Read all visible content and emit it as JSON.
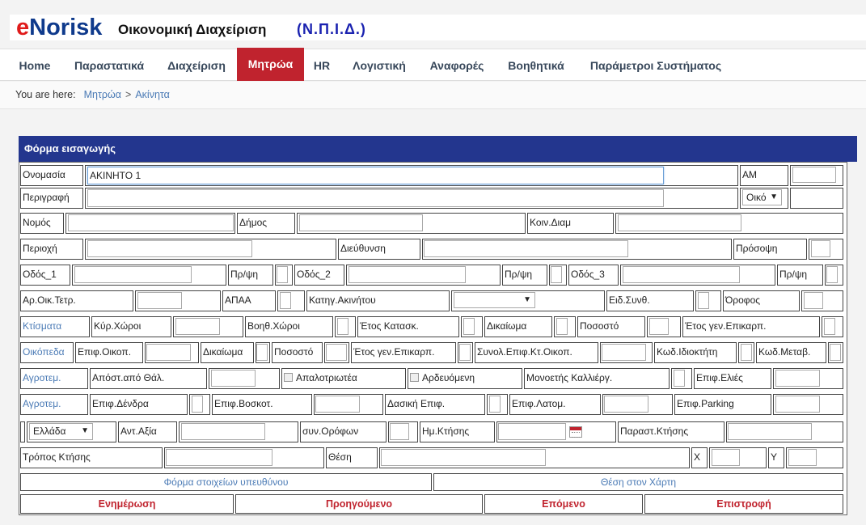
{
  "header": {
    "logo_e": "e",
    "logo_rest": "Norisk",
    "title": "Οικονομική Διαχείριση",
    "org": "(Ν.Π.Ι.Δ.)"
  },
  "nav": {
    "items": [
      "Home",
      "Παραστατικά",
      "Διαχείριση",
      "Μητρώα",
      "HR",
      "Λογιστική",
      "Αναφορές",
      "Βοηθητικά",
      "Παράμετροι Συστήματος"
    ],
    "active": "Μητρώα"
  },
  "breadcrumb": {
    "label": "You are here:",
    "items": [
      "Μητρώα",
      "Ακίνητα"
    ],
    "separator": ">"
  },
  "form": {
    "title": "Φόρμα εισαγωγής",
    "labels": {
      "onomasia": "Ονομασία",
      "am": "ΑΜ",
      "perigrafi": "Περιγραφή",
      "nomos": "Νομός",
      "dimos": "Δήμος",
      "koin_diam": "Κοιν.Διαμ",
      "perioxi": "Περιοχή",
      "dieuthynsi": "Διεύθυνση",
      "prosopsi": "Πρόσοψη",
      "odos_1": "Οδός_1",
      "odos_2": "Οδός_2",
      "odos_3": "Οδός_3",
      "pr_psi": "Πρ/ψη",
      "ar_oik_tetr": "Αρ.Οικ.Τετρ.",
      "apaa": "ΑΠΑΑ",
      "katig_akinitou": "Κατηγ.Ακινήτου",
      "eid_synth": "Ειδ.Συνθ.",
      "orofos": "Όροφος",
      "ktismata": "Κτίσματα",
      "kyr_xoroi": "Κύρ.Χώροι",
      "voith_xoroi": "Βοηθ.Χώροι",
      "etos_katask": "Έτος Κατασκ.",
      "dikaioma": "Δικαίωμα",
      "pososto": "Ποσοστό",
      "etos_gen_epikarp": "Έτος γεν.Επικαρπ.",
      "oikopeda": "Οικόπεδα",
      "epif_oikop": "Επιφ.Οικοπ.",
      "synol_epif": "Συνολ.Επιφ.Κτ.Οικοπ.",
      "kod_idioktiti": "Κωδ.Ιδιοκτήτη",
      "kod_metav": "Κωδ.Μεταβ.",
      "agrotem": "Αγροτεμ.",
      "apost_thal": "Απόστ.από Θάλ.",
      "apalotriotea": "Απαλοτριωτέα",
      "ardevomeni": "Αρδευόμενη",
      "monoetis": "Μονοετής Καλλιέργ.",
      "epif_elies": "Επιφ.Ελιές",
      "epif_dendra": "Επιφ.Δένδρα",
      "epif_voskot": "Επιφ.Βοσκοτ.",
      "dasiki_epif": "Δασική Επιφ.",
      "epif_latom": "Επιφ.Λατομ.",
      "epif_parking": "Επιφ.Parking",
      "ant_axia": "Αντ.Αξία",
      "syn_orofon": "συν.Ορόφων",
      "im_ktisis": "Ημ.Κτήσης",
      "parast_ktisis": "Παραστ.Κτήσης",
      "tropos_ktisis": "Τρόπος Κτήσης",
      "thesi": "Θέση",
      "x": "X",
      "y": "Y"
    },
    "values": {
      "onomasia": "ΑΚΙΝΗΤΟ 1",
      "type_select": "Οικό",
      "country_select": "Ελλάδα"
    },
    "buttons": {
      "form_ypeuthynou": "Φόρμα στοιχείων υπευθύνου",
      "thesi_xarti": "Θέση στον Χάρτη",
      "enimerosi": "Ενημέρωση",
      "proigoumeno": "Προηγούμενο",
      "epomeno": "Επόμενο",
      "epistrofi": "Επιστροφή"
    }
  },
  "icons": {
    "dropdown": "▼",
    "calendar": "calendar-icon"
  },
  "colors": {
    "brand_red": "#c0232e",
    "panel_blue": "#23368e",
    "link_blue": "#4a7ab5"
  }
}
